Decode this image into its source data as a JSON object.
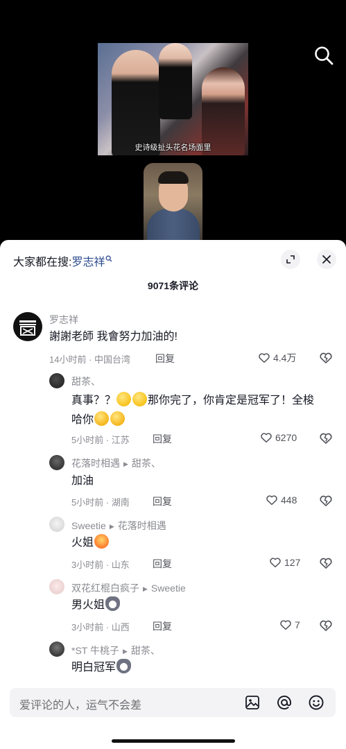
{
  "video": {
    "caption": "史诗级扯头花名场面里"
  },
  "panel": {
    "suggest_prefix": "大家都在搜:",
    "suggest_keyword": "罗志祥",
    "count_title": "9071条评论",
    "input_placeholder": "爱评论的人，运气不会差"
  },
  "comments": [
    {
      "user": "罗志祥",
      "text": "謝謝老師 我會努力加油的!",
      "meta": "14小时前 · 中国台湾",
      "reply": "回复",
      "likes": "4.4万"
    },
    {
      "user": "甜茶、",
      "text_before": "真事？？",
      "text_middle": "那你完了，你肯定是冠军了！全梭",
      "text_line2": "哈你",
      "meta": "5小时前 · 江苏",
      "reply": "回复",
      "likes": "6270"
    },
    {
      "user": "花落时相遇",
      "reply_to": "甜茶、",
      "text": "加油",
      "meta": "5小时前 · 湖南",
      "reply": "回复",
      "likes": "448"
    },
    {
      "user": "Sweetie",
      "reply_to": "花落时相遇",
      "text": "火姐",
      "meta": "3小时前 · 山东",
      "reply": "回复",
      "likes": "127"
    },
    {
      "user": "双花红棍白疯子",
      "reply_to": "Sweetie",
      "text": "男火姐",
      "meta": "3小时前 · 山西",
      "reply": "回复",
      "likes": "7"
    },
    {
      "user": "*ST 牛桃子",
      "reply_to": "甜茶、",
      "text": "明白冠军"
    }
  ],
  "icons": {
    "search": "search-icon",
    "expand": "expand-icon",
    "close": "close-icon",
    "like": "heart-icon",
    "dislike": "broken-heart-icon",
    "image": "image-icon",
    "mention": "at-icon",
    "emoji": "emoji-icon"
  },
  "colors": {
    "keyword": "#2b4b8d",
    "secondary_text": "#8a8b91"
  }
}
